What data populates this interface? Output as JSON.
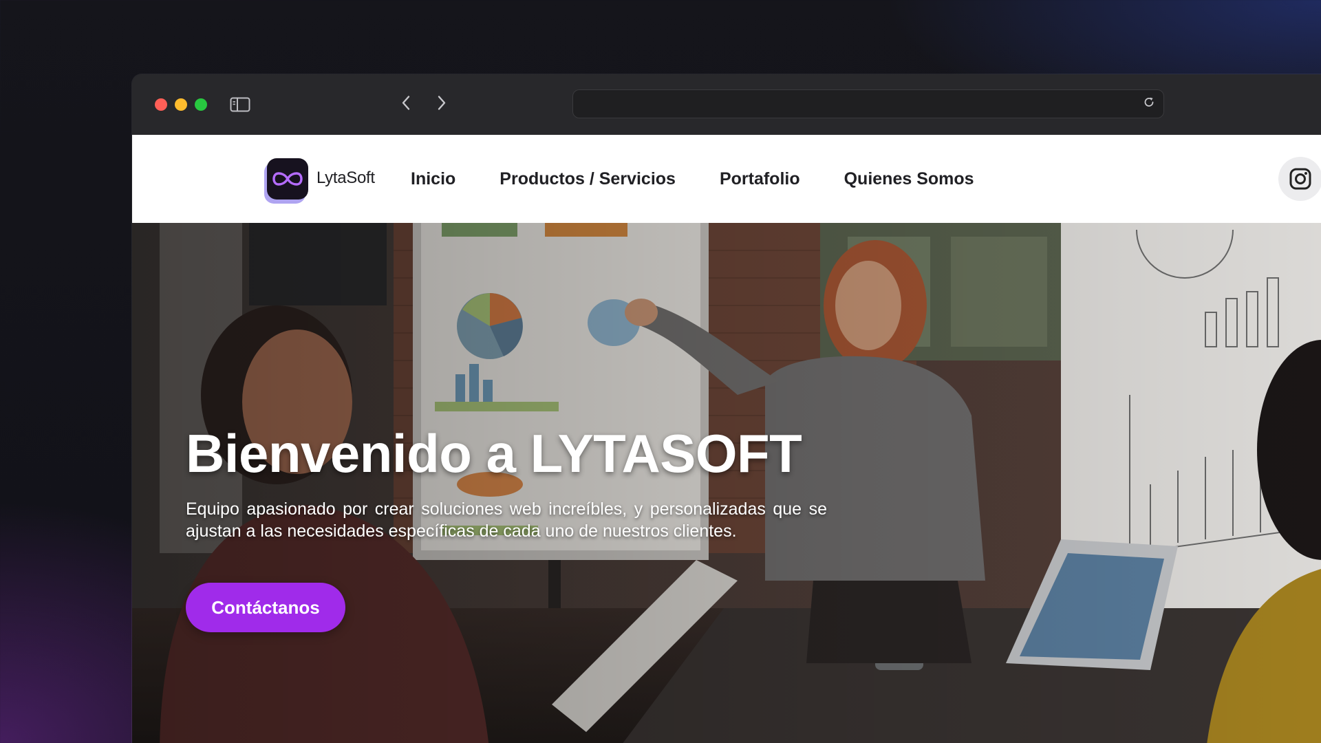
{
  "browser": {
    "url": ""
  },
  "site": {
    "logo": {
      "name": "LytaSoft"
    },
    "nav": [
      {
        "label": "Inicio"
      },
      {
        "label": "Productos / Servicios"
      },
      {
        "label": "Portafolio"
      },
      {
        "label": "Quienes Somos"
      }
    ],
    "social": {
      "icon": "instagram-icon"
    }
  },
  "hero": {
    "title": "Bienvenido a LYTASOFT",
    "description": "Equipo apasionado por crear soluciones web increíbles, y personalizadas que se ajustan a las necesidades específicas de cada uno de nuestros clientes.",
    "cta_label": "Contáctanos"
  },
  "colors": {
    "accent": "#a02bea",
    "traffic_red": "#ff5f57",
    "traffic_yellow": "#febc2e",
    "traffic_green": "#28c840"
  }
}
